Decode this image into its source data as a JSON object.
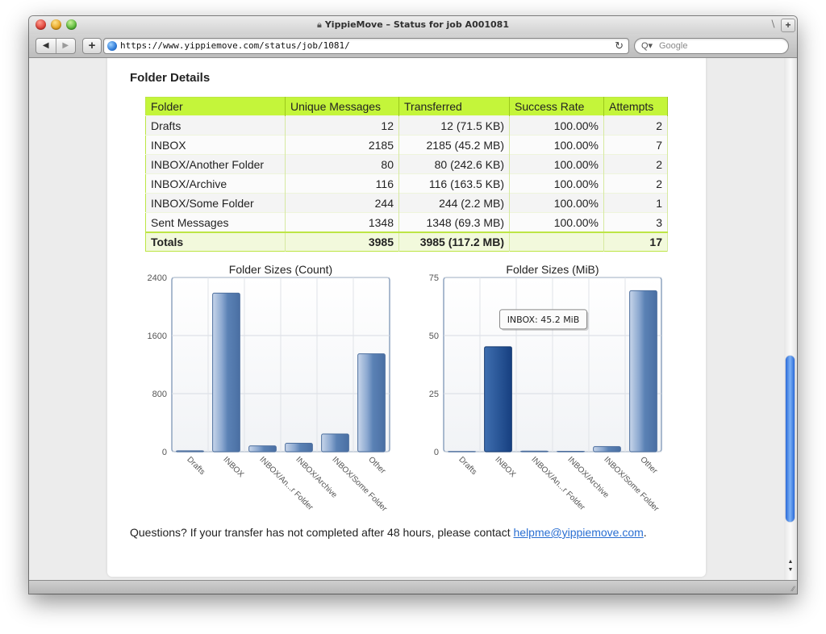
{
  "window": {
    "title": "YippieMove – Status for job A001081",
    "url": "https://www.yippiemove.com/status/job/1081/",
    "search_placeholder": "Google"
  },
  "section": {
    "title": "Folder Details"
  },
  "table": {
    "headers": [
      "Folder",
      "Unique Messages",
      "Transferred",
      "Success Rate",
      "Attempts"
    ],
    "rows": [
      [
        "Drafts",
        "12",
        "12 (71.5 KB)",
        "100.00%",
        "2"
      ],
      [
        "INBOX",
        "2185",
        "2185 (45.2 MB)",
        "100.00%",
        "7"
      ],
      [
        "INBOX/Another Folder",
        "80",
        "80 (242.6 KB)",
        "100.00%",
        "2"
      ],
      [
        "INBOX/Archive",
        "116",
        "116 (163.5 KB)",
        "100.00%",
        "2"
      ],
      [
        "INBOX/Some Folder",
        "244",
        "244 (2.2 MB)",
        "100.00%",
        "1"
      ],
      [
        "Sent Messages",
        "1348",
        "1348 (69.3 MB)",
        "100.00%",
        "3"
      ]
    ],
    "totals": [
      "Totals",
      "3985",
      "3985 (117.2 MB)",
      "",
      "17"
    ]
  },
  "chart_data": [
    {
      "type": "bar",
      "title": "Folder Sizes (Count)",
      "categories": [
        "Drafts",
        "INBOX",
        "INBOX/An...r Folder",
        "INBOX/Archive",
        "INBOX/Some Folder",
        "Other"
      ],
      "values": [
        12,
        2185,
        80,
        116,
        244,
        1348
      ],
      "ylim": [
        0,
        2400
      ],
      "yticks": [
        0,
        800,
        1600,
        2400
      ],
      "grid": true
    },
    {
      "type": "bar",
      "title": "Folder Sizes (MiB)",
      "categories": [
        "Drafts",
        "INBOX",
        "INBOX/An...r Folder",
        "INBOX/Archive",
        "INBOX/Some Folder",
        "Other"
      ],
      "values": [
        0.07,
        45.2,
        0.24,
        0.16,
        2.2,
        69.3
      ],
      "ylim": [
        0,
        75
      ],
      "yticks": [
        0,
        25,
        50,
        75
      ],
      "grid": true,
      "tooltip": {
        "category": "INBOX",
        "text": "INBOX: 45.2 MiB"
      }
    }
  ],
  "footer": {
    "text": "Questions? If your transfer has not completed after 48 hours, please contact ",
    "email": "helpme@yippiemove.com",
    "suffix": "."
  },
  "colors": {
    "header_green": "#c4f53a",
    "bar_blue": "#5b82b5",
    "bar_highlight": "#1f4f93",
    "link": "#2a6fd2"
  }
}
